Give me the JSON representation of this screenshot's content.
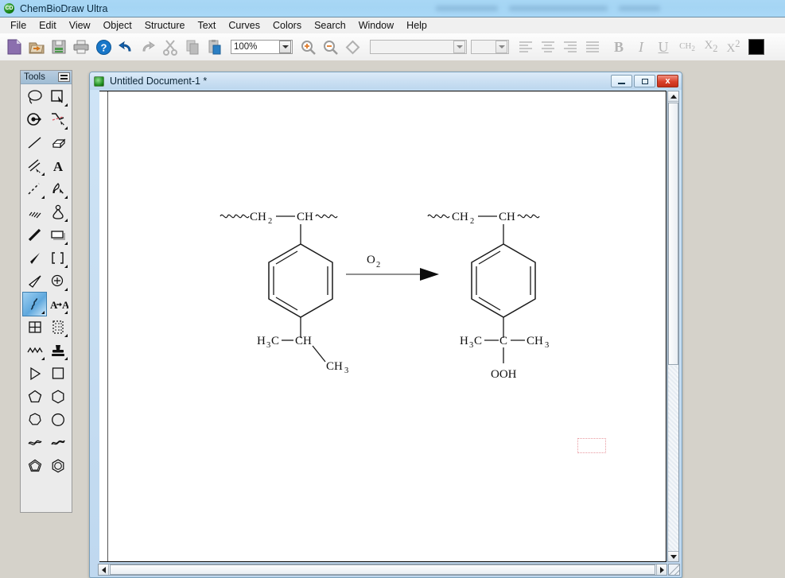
{
  "app": {
    "title": "ChemBioDraw Ultra",
    "logo_icon": "chembiodraw-logo-icon",
    "watermark_present": true
  },
  "menubar": {
    "items": [
      {
        "label": "File"
      },
      {
        "label": "Edit"
      },
      {
        "label": "View"
      },
      {
        "label": "Object"
      },
      {
        "label": "Structure"
      },
      {
        "label": "Text"
      },
      {
        "label": "Curves"
      },
      {
        "label": "Colors"
      },
      {
        "label": "Search"
      },
      {
        "label": "Window"
      },
      {
        "label": "Help"
      }
    ]
  },
  "toolbar": {
    "buttons": [
      {
        "name": "new-document-icon",
        "tip": "New"
      },
      {
        "name": "open-document-icon",
        "tip": "Open"
      },
      {
        "name": "save-document-icon",
        "tip": "Save"
      },
      {
        "name": "print-icon",
        "tip": "Print"
      },
      {
        "name": "help-icon",
        "tip": "Help"
      },
      {
        "name": "undo-icon",
        "tip": "Undo"
      },
      {
        "name": "redo-icon",
        "tip": "Redo"
      },
      {
        "name": "cut-icon",
        "tip": "Cut"
      },
      {
        "name": "copy-icon",
        "tip": "Copy"
      },
      {
        "name": "paste-icon",
        "tip": "Paste"
      }
    ],
    "zoom_combo": {
      "value": "100%",
      "placeholder": "100%"
    },
    "zoom_in_icon": "zoom-in-icon",
    "zoom_out_icon": "zoom-out-icon",
    "shape_icon": "diamond-shape-icon",
    "font_combo": {
      "value": "",
      "placeholder": ""
    },
    "size_combo": {
      "value": "",
      "placeholder": ""
    },
    "align_icons": [
      "align-left-icon",
      "align-center-icon",
      "align-right-icon",
      "align-justify-icon"
    ],
    "bold_label": "B",
    "italic_label": "I",
    "underline_label": "U",
    "formula_label": "CH2",
    "subscript_label": "X2",
    "superscript_label": "X2",
    "color_swatch": "#000000"
  },
  "tools_palette": {
    "title": "Tools",
    "grip_icon": "grip-handle-icon",
    "items": [
      {
        "name": "lasso-select-tool"
      },
      {
        "name": "marquee-select-tool"
      },
      {
        "name": "rotate-tool"
      },
      {
        "name": "eraser-dash-tool"
      },
      {
        "name": "solid-bond-tool"
      },
      {
        "name": "eraser-tool"
      },
      {
        "name": "multiple-bond-tool"
      },
      {
        "name": "text-tool"
      },
      {
        "name": "dashed-bond-tool"
      },
      {
        "name": "pen-tool"
      },
      {
        "name": "hashed-bond-tool"
      },
      {
        "name": "flask-tool"
      },
      {
        "name": "bold-bond-tool"
      },
      {
        "name": "rectangle-tool"
      },
      {
        "name": "wedge-bond-tool"
      },
      {
        "name": "bracket-tool"
      },
      {
        "name": "hollow-wedge-tool"
      },
      {
        "name": "orbital-tool"
      },
      {
        "name": "chain-squiggle-tool",
        "selected": true
      },
      {
        "name": "atom-replace-tool"
      },
      {
        "name": "table-tool"
      },
      {
        "name": "pattern-fill-tool"
      },
      {
        "name": "polymer-chain-tool"
      },
      {
        "name": "stamp-tool"
      },
      {
        "name": "triangle-tool"
      },
      {
        "name": "square-tool"
      },
      {
        "name": "pentagon-tool"
      },
      {
        "name": "hexagon-tool"
      },
      {
        "name": "heptagon-tool"
      },
      {
        "name": "circle-tool"
      },
      {
        "name": "ribbon-tool"
      },
      {
        "name": "wave-ribbon-tool"
      },
      {
        "name": "cyclopentadiene-tool"
      },
      {
        "name": "benzene-ring-tool"
      }
    ]
  },
  "document_window": {
    "title": "Untitled Document-1 *",
    "icon": "document-icon",
    "minimize_label": "",
    "maximize_label": "",
    "close_label": "x"
  },
  "canvas": {
    "reaction": {
      "reagent_label": "O",
      "reagent_subscript": "2",
      "arrow_icon": "reaction-arrow-icon",
      "reactant": {
        "chain_left_label": "CH",
        "chain_left_sub": "2",
        "chain_right_label": "CH",
        "ring": "benzene",
        "methyl_left_label": "H",
        "methyl_left_sub": "3",
        "methyl_left_tail": "C",
        "center_label": "CH",
        "methyl_down_label": "CH",
        "methyl_down_sub": "3"
      },
      "product": {
        "chain_left_label": "CH",
        "chain_left_sub": "2",
        "chain_right_label": "CH",
        "ring": "benzene",
        "methyl_left_label": "H",
        "methyl_left_sub": "3",
        "methyl_left_tail": "C",
        "center_label": "C",
        "methyl_right_label": "CH",
        "methyl_right_sub": "3",
        "hydroperoxy_label": "OOH",
        "hydroperoxy_selected": true,
        "selection_color": "#e8989f"
      }
    },
    "vertical_scrollbar": {
      "up_icon": "scroll-up-icon",
      "down_icon": "scroll-down-icon"
    },
    "horizontal_scrollbar": {
      "left_icon": "scroll-left-icon",
      "right_icon": "scroll-right-icon"
    },
    "resize_grip_icon": "resize-grip-icon"
  }
}
